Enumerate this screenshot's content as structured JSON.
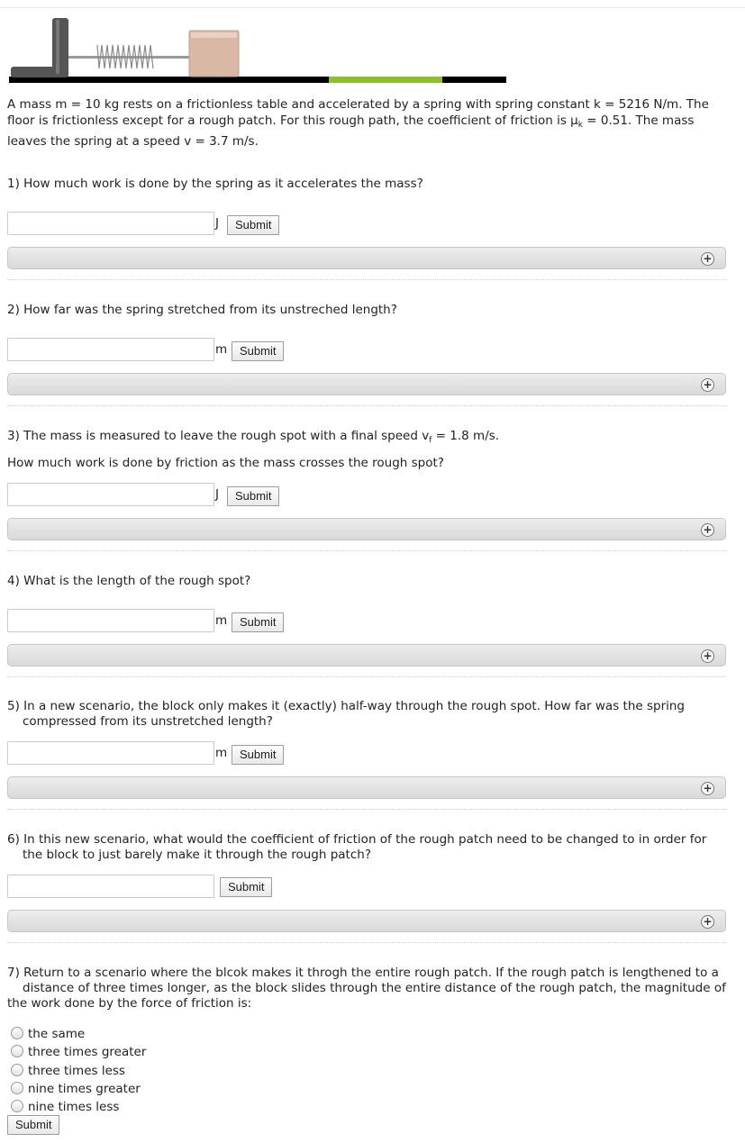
{
  "figure": {
    "rough_patch_color": "#8dc21f",
    "floor_color": "#000000",
    "wall_color": "#555555",
    "block_color": "#d9b9a6"
  },
  "problem": {
    "text_part1": "A mass m = 10 kg rests on a frictionless table and accelerated by a spring with spring constant k = 5216 N/m. The floor is frictionless except for a rough patch. For this rough path, the coefficient of friction is μ",
    "text_sub": "k",
    "text_part2": " = 0.51. The mass leaves the spring at a speed v = 3.7 m/s."
  },
  "submit_label": "Submit",
  "expand_icon_glyph": "+",
  "questions": [
    {
      "text": "1) How much work is done by the spring as it accelerates the mass?",
      "unit": "J"
    },
    {
      "text": "2) How far was the spring stretched from its unstreched length?",
      "unit": "m"
    },
    {
      "text_part1": "3) The mass is measured to leave the rough spot with a final speed v",
      "text_sub": "f",
      "text_part2": " = 1.8 m/s.",
      "text_line2": "How much work is done by friction as the mass crosses the rough spot?",
      "unit": "J"
    },
    {
      "text": "4) What is the length of the rough spot?",
      "unit": "m"
    },
    {
      "text": "5) In a new scenario, the block only makes it (exactly) half-way through the rough spot. How far was the spring compressed from its unstretched length?",
      "unit": "m"
    },
    {
      "text": "6) In this new scenario, what would the coefficient of friction of the rough patch need to be changed to in order for the block to just barely make it through the rough patch?",
      "unit": ""
    },
    {
      "text_line1": "7) Return to a scenario where the blcok makes it throgh the entire rough patch. If the rough patch is lengthened to a",
      "text_line2": "distance of three times longer, as the block slides through the entire distance of the rough patch, the magnitude of",
      "text_line3": "the work done by the force of friction is:",
      "options": [
        "the same",
        "three times greater",
        "three times less",
        "nine times greater",
        "nine times less"
      ]
    }
  ]
}
